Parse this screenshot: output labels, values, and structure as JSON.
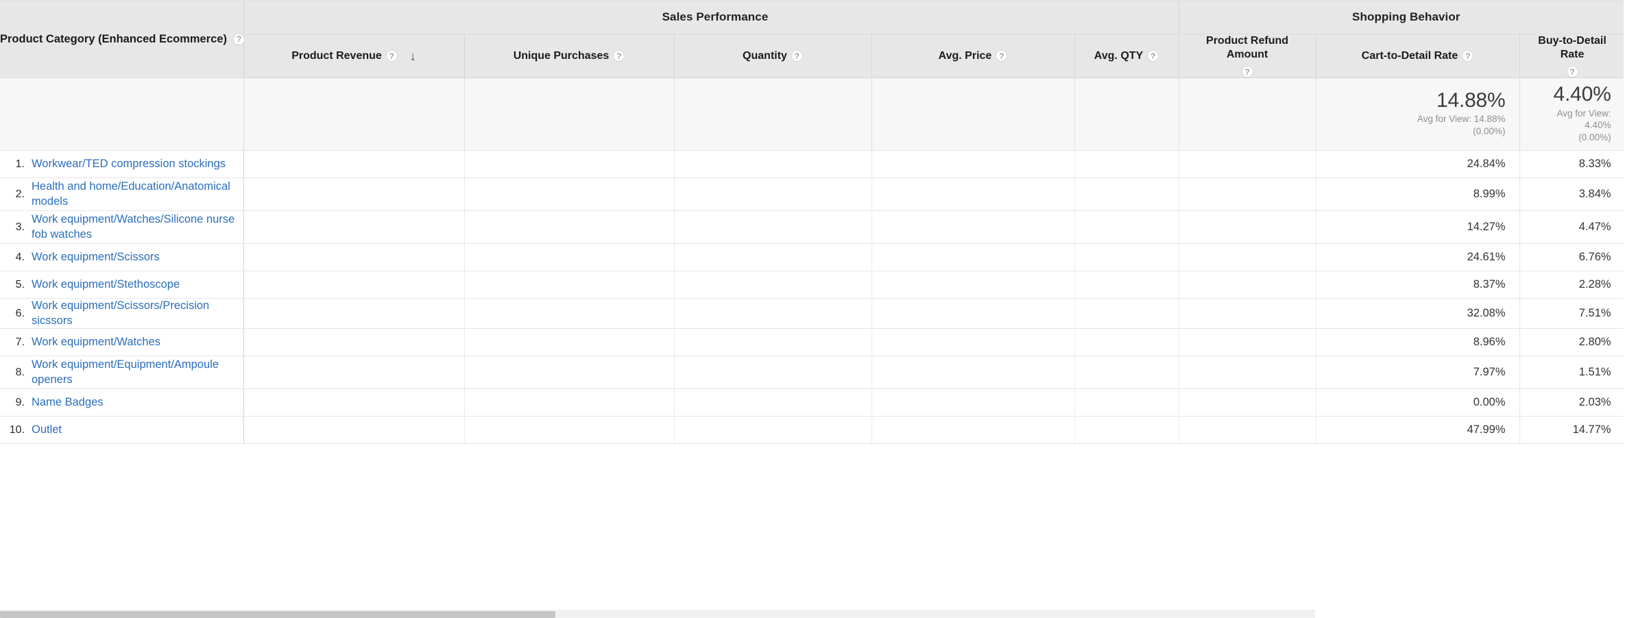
{
  "table": {
    "dimension_header": {
      "label": "Product Category (Enhanced Ecommerce)",
      "help": "?"
    },
    "group_headers": [
      {
        "label": "Sales Performance"
      },
      {
        "label": "Shopping Behavior"
      }
    ],
    "metric_headers": [
      {
        "label": "Product Revenue",
        "help": "?",
        "sorted": true,
        "sort_arrow": "↓"
      },
      {
        "label": "Unique Purchases",
        "help": "?"
      },
      {
        "label": "Quantity",
        "help": "?"
      },
      {
        "label": "Avg. Price",
        "help": "?"
      },
      {
        "label": "Avg. QTY",
        "help": "?"
      },
      {
        "label": "Product Refund Amount",
        "help": "?"
      },
      {
        "label": "Cart-to-Detail Rate",
        "help": "?"
      },
      {
        "label": "Buy-to-Detail Rate",
        "help": "?"
      }
    ],
    "summary": {
      "cart_to_detail": {
        "value": "14.88%",
        "avg_label": "Avg for View: 14.88%",
        "avg_delta": "(0.00%)"
      },
      "buy_to_detail": {
        "value": "4.40%",
        "avg_label": "Avg for View: 4.40%",
        "avg_delta": "(0.00%)"
      }
    },
    "rows": [
      {
        "rank": "1.",
        "category": "Workwear/TED compression stockings",
        "cart_to_detail": "24.84%",
        "buy_to_detail": "8.33%"
      },
      {
        "rank": "2.",
        "category": "Health and home/Education/Anatomical models",
        "cart_to_detail": "8.99%",
        "buy_to_detail": "3.84%"
      },
      {
        "rank": "3.",
        "category": "Work equipment/Watches/Silicone nurse fob watches",
        "cart_to_detail": "14.27%",
        "buy_to_detail": "4.47%"
      },
      {
        "rank": "4.",
        "category": "Work equipment/Scissors",
        "cart_to_detail": "24.61%",
        "buy_to_detail": "6.76%"
      },
      {
        "rank": "5.",
        "category": "Work equipment/Stethoscope",
        "cart_to_detail": "8.37%",
        "buy_to_detail": "2.28%"
      },
      {
        "rank": "6.",
        "category": "Work equipment/Scissors/Precision sicssors",
        "cart_to_detail": "32.08%",
        "buy_to_detail": "7.51%"
      },
      {
        "rank": "7.",
        "category": "Work equipment/Watches",
        "cart_to_detail": "8.96%",
        "buy_to_detail": "2.80%"
      },
      {
        "rank": "8.",
        "category": "Work equipment/Equipment/Ampoule openers",
        "cart_to_detail": "7.97%",
        "buy_to_detail": "1.51%"
      },
      {
        "rank": "9.",
        "category": "Name Badges",
        "cart_to_detail": "0.00%",
        "buy_to_detail": "2.03%"
      },
      {
        "rank": "10.",
        "category": "Outlet",
        "cart_to_detail": "47.99%",
        "buy_to_detail": "14.77%"
      }
    ]
  },
  "colors": {
    "link": "#2a6ebb",
    "header_bg": "#e7e7e7",
    "summary_bg": "#f7f7f7"
  }
}
